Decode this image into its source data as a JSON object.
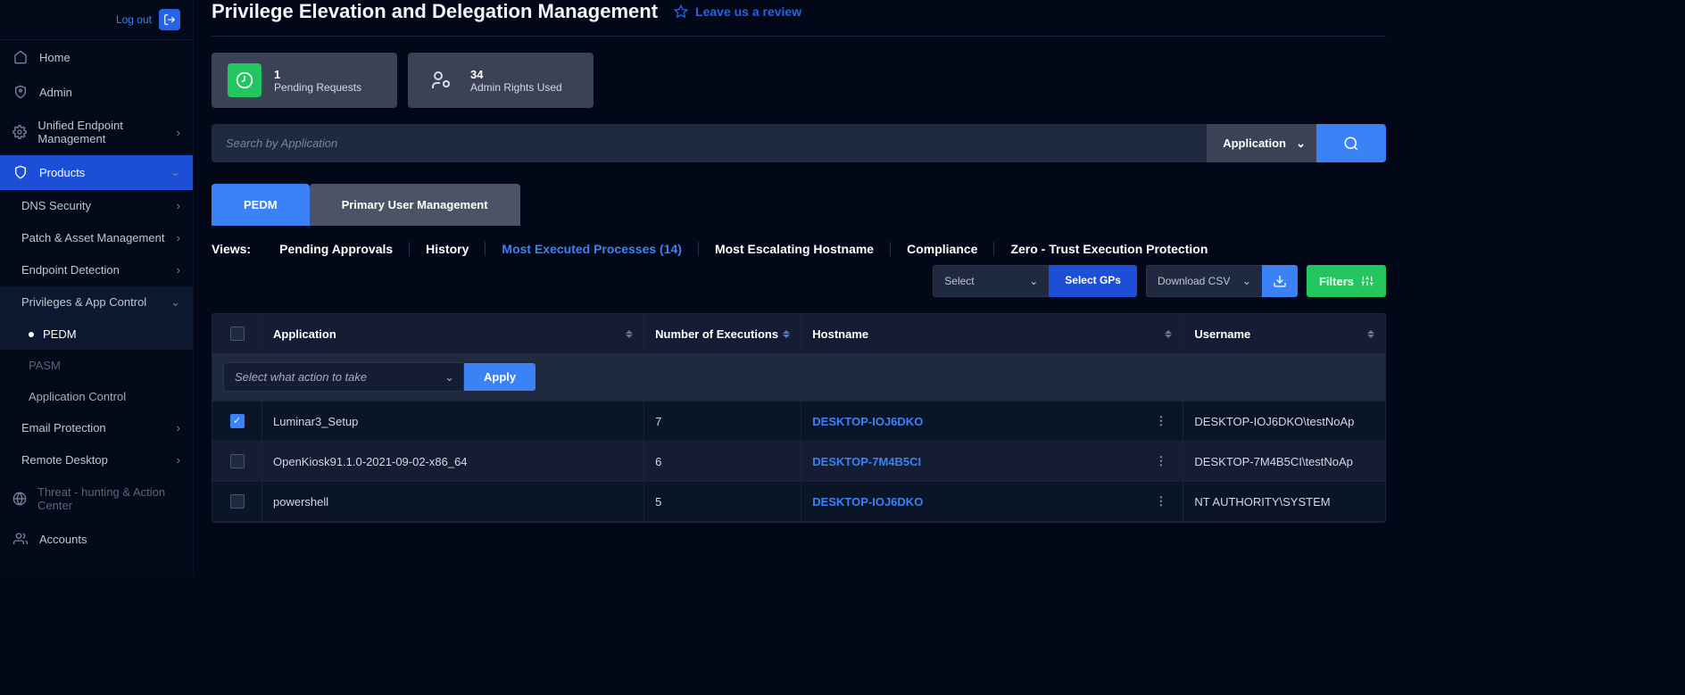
{
  "header": {
    "logout": "Log out",
    "title": "Privilege Elevation and Delegation Management",
    "review": "Leave us a review"
  },
  "nav": {
    "home": "Home",
    "admin": "Admin",
    "uem": "Unified Endpoint Management",
    "products": "Products",
    "dns": "DNS Security",
    "patch": "Patch & Asset Management",
    "edr": "Endpoint Detection",
    "pac": "Privileges & App Control",
    "pedm": "PEDM",
    "pasm": "PASM",
    "appctrl": "Application Control",
    "email": "Email Protection",
    "remote": "Remote Desktop",
    "threat": "Threat - hunting & Action Center",
    "accounts": "Accounts"
  },
  "stats": {
    "pending_num": "1",
    "pending_lbl": "Pending Requests",
    "admin_num": "34",
    "admin_lbl": "Admin Rights Used"
  },
  "search": {
    "placeholder": "Search by Application",
    "type": "Application"
  },
  "tabs": {
    "pedm": "PEDM",
    "pum": "Primary User Management"
  },
  "views": {
    "label": "Views:",
    "pending": "Pending Approvals",
    "history": "History",
    "most_exec": "Most Executed Processes (14)",
    "most_esc": "Most Escalating Hostname",
    "compliance": "Compliance",
    "zero": "Zero - Trust Execution Protection"
  },
  "toolbar": {
    "select": "Select",
    "select_gps": "Select GPs",
    "download": "Download CSV",
    "filters": "Filters"
  },
  "table": {
    "headers": {
      "app": "Application",
      "num": "Number of Executions",
      "host": "Hostname",
      "user": "Username"
    },
    "action_placeholder": "Select what action to take",
    "apply": "Apply",
    "rows": [
      {
        "checked": true,
        "app": "Luminar3_Setup",
        "num": "7",
        "host": "DESKTOP-IOJ6DKO",
        "user": "DESKTOP-IOJ6DKO\\testNoAp"
      },
      {
        "checked": false,
        "app": "OpenKiosk91.1.0-2021-09-02-x86_64",
        "num": "6",
        "host": "DESKTOP-7M4B5CI",
        "user": "DESKTOP-7M4B5CI\\testNoAp"
      },
      {
        "checked": false,
        "app": "powershell",
        "num": "5",
        "host": "DESKTOP-IOJ6DKO",
        "user": "NT AUTHORITY\\SYSTEM"
      }
    ]
  }
}
